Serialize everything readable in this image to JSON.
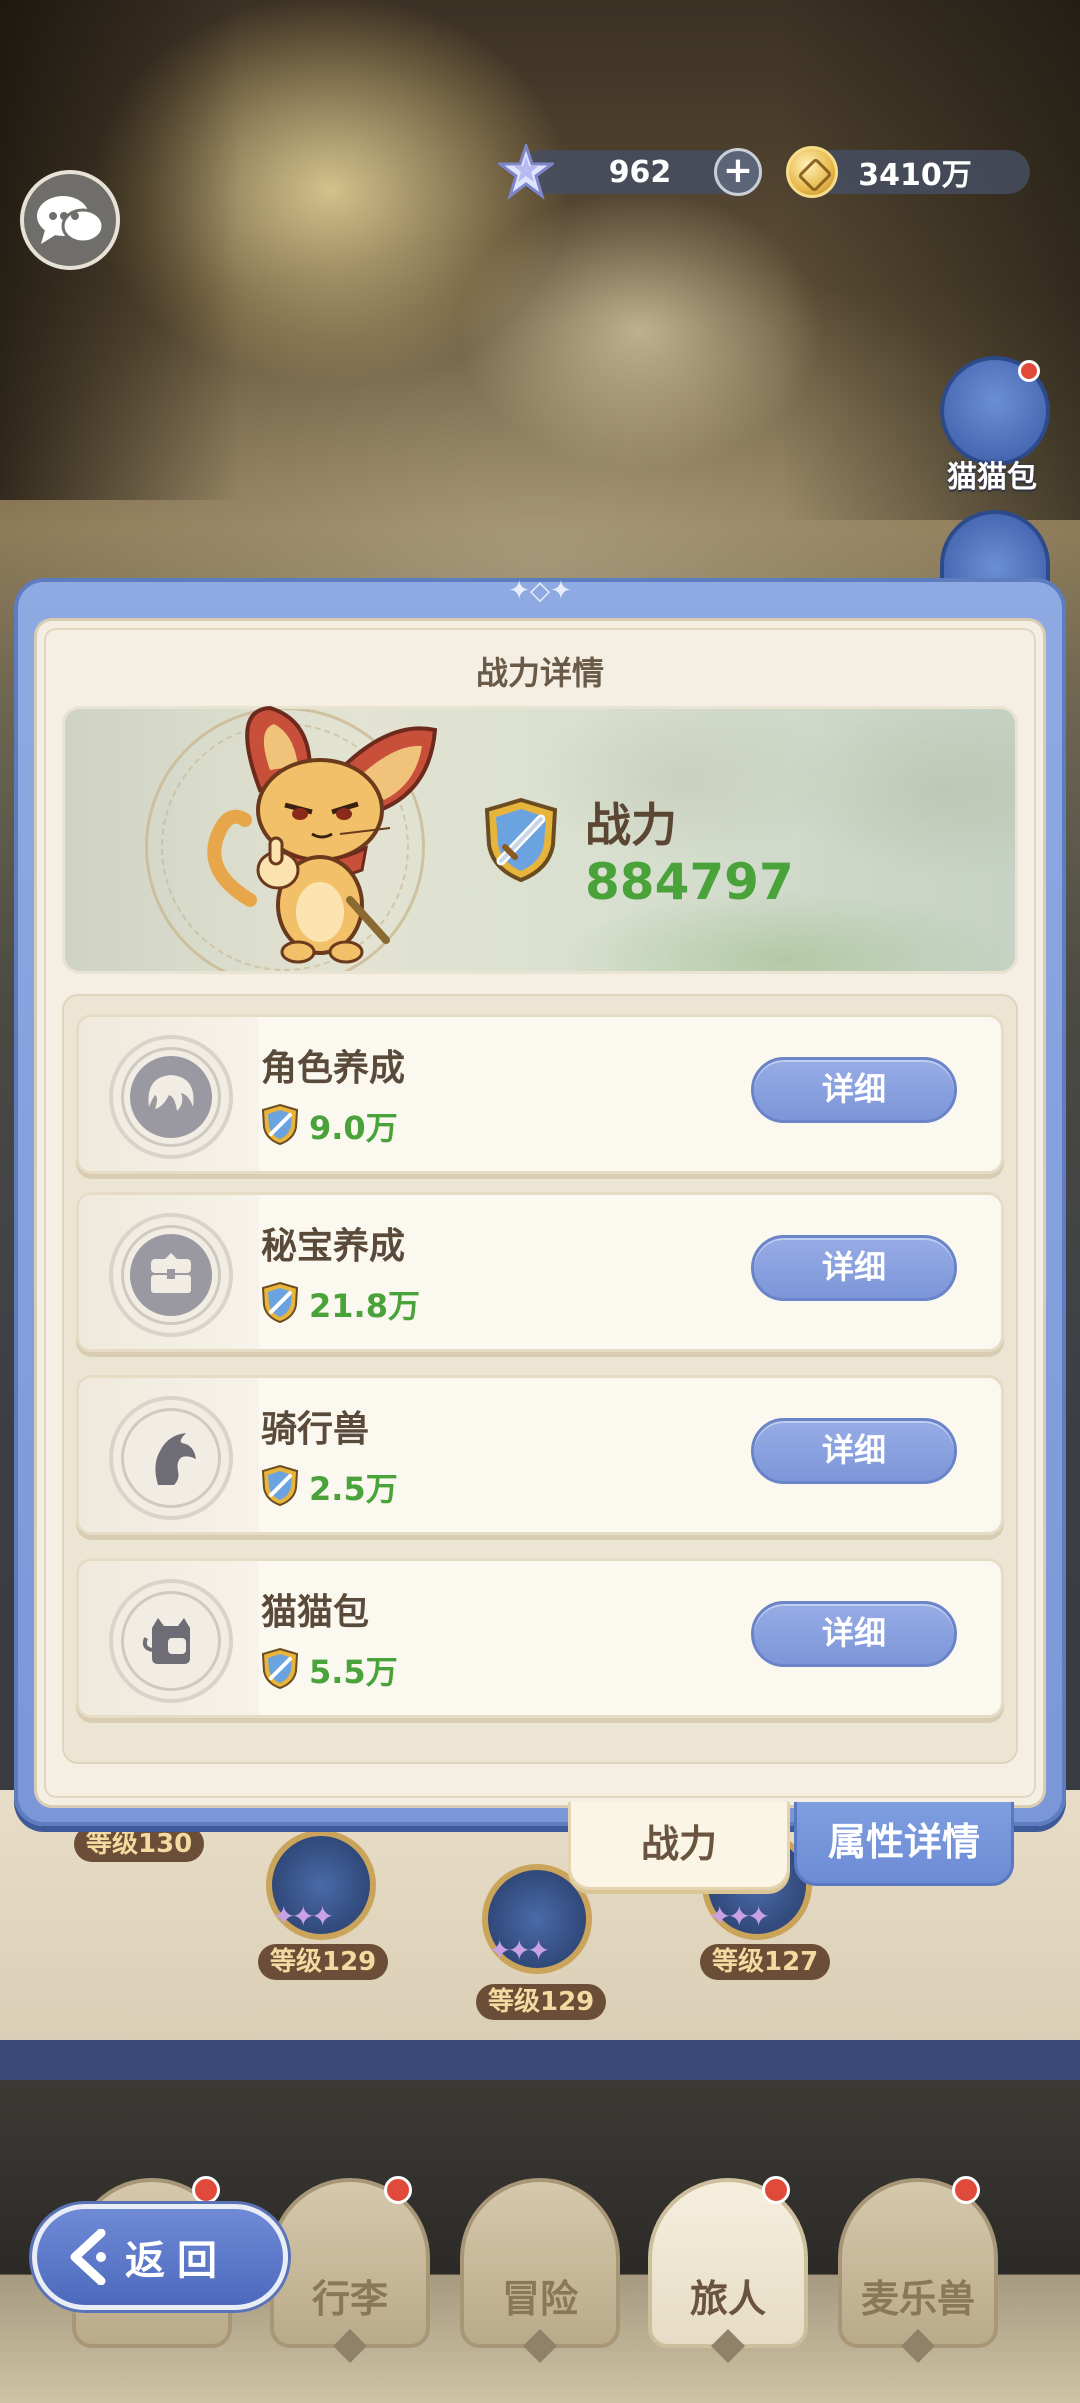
{
  "currency": {
    "gems": "962",
    "gold": "3410万"
  },
  "side_menu": {
    "cat_bag_label": "猫猫包"
  },
  "dialog": {
    "title": "战力详情",
    "power_label": "战力",
    "power_value": "884797",
    "rows": [
      {
        "title": "角色养成",
        "value": "9.0万",
        "button": "详细",
        "icon": "character-face-icon"
      },
      {
        "title": "秘宝养成",
        "value": "21.8万",
        "button": "详细",
        "icon": "treasure-chest-icon"
      },
      {
        "title": "骑行兽",
        "value": "2.5万",
        "button": "详细",
        "icon": "horse-head-icon"
      },
      {
        "title": "猫猫包",
        "value": "5.5万",
        "button": "详细",
        "icon": "cat-bag-icon"
      }
    ]
  },
  "tabs": {
    "power": "战力",
    "attributes": "属性详情"
  },
  "background_levels": [
    "等级130",
    "等级129",
    "等级129",
    "等级127"
  ],
  "bottom_nav": {
    "back": "返回",
    "items": [
      "行李",
      "冒险",
      "旅人",
      "麦乐兽"
    ],
    "active": "旅人"
  },
  "colors": {
    "accent_blue": "#7d96d8",
    "power_green": "#4aa23a",
    "panel_cream": "#f4efe2",
    "badge_red": "#e04a3a"
  }
}
